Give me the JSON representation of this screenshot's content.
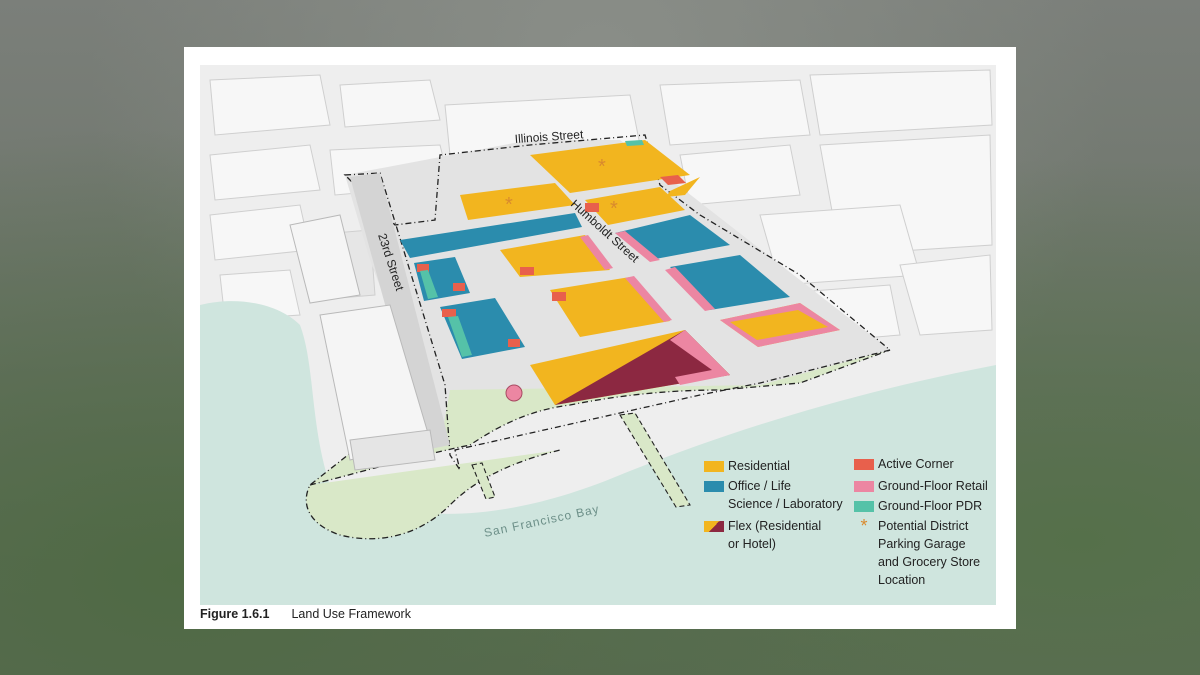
{
  "figure": {
    "number": "Figure 1.6.1",
    "title": "Land Use Framework"
  },
  "map": {
    "streets": {
      "illinois": "Illinois Street",
      "humboldt": "Humboldt Street",
      "twentythird": "23rd Street"
    },
    "water_label": "San Francisco Bay"
  },
  "legend": {
    "residential": "Residential",
    "office": "Office / Life\nScience / Laboratory",
    "flex": "Flex (Residential\nor Hotel)",
    "active_corner": "Active Corner",
    "retail": "Ground-Floor Retail",
    "pdr": "Ground-Floor PDR",
    "garage": "Potential District\nParking Garage\nand Grocery Store\nLocation"
  },
  "colors": {
    "residential": "#f2b51f",
    "office": "#2b8cad",
    "flex_dark": "#8c2841",
    "active_corner": "#e8604c",
    "retail": "#ec86a2",
    "pdr": "#55c2a8",
    "garage_star": "#d98a2e",
    "water": "#cfe5de",
    "park": "#d9e8c8"
  }
}
